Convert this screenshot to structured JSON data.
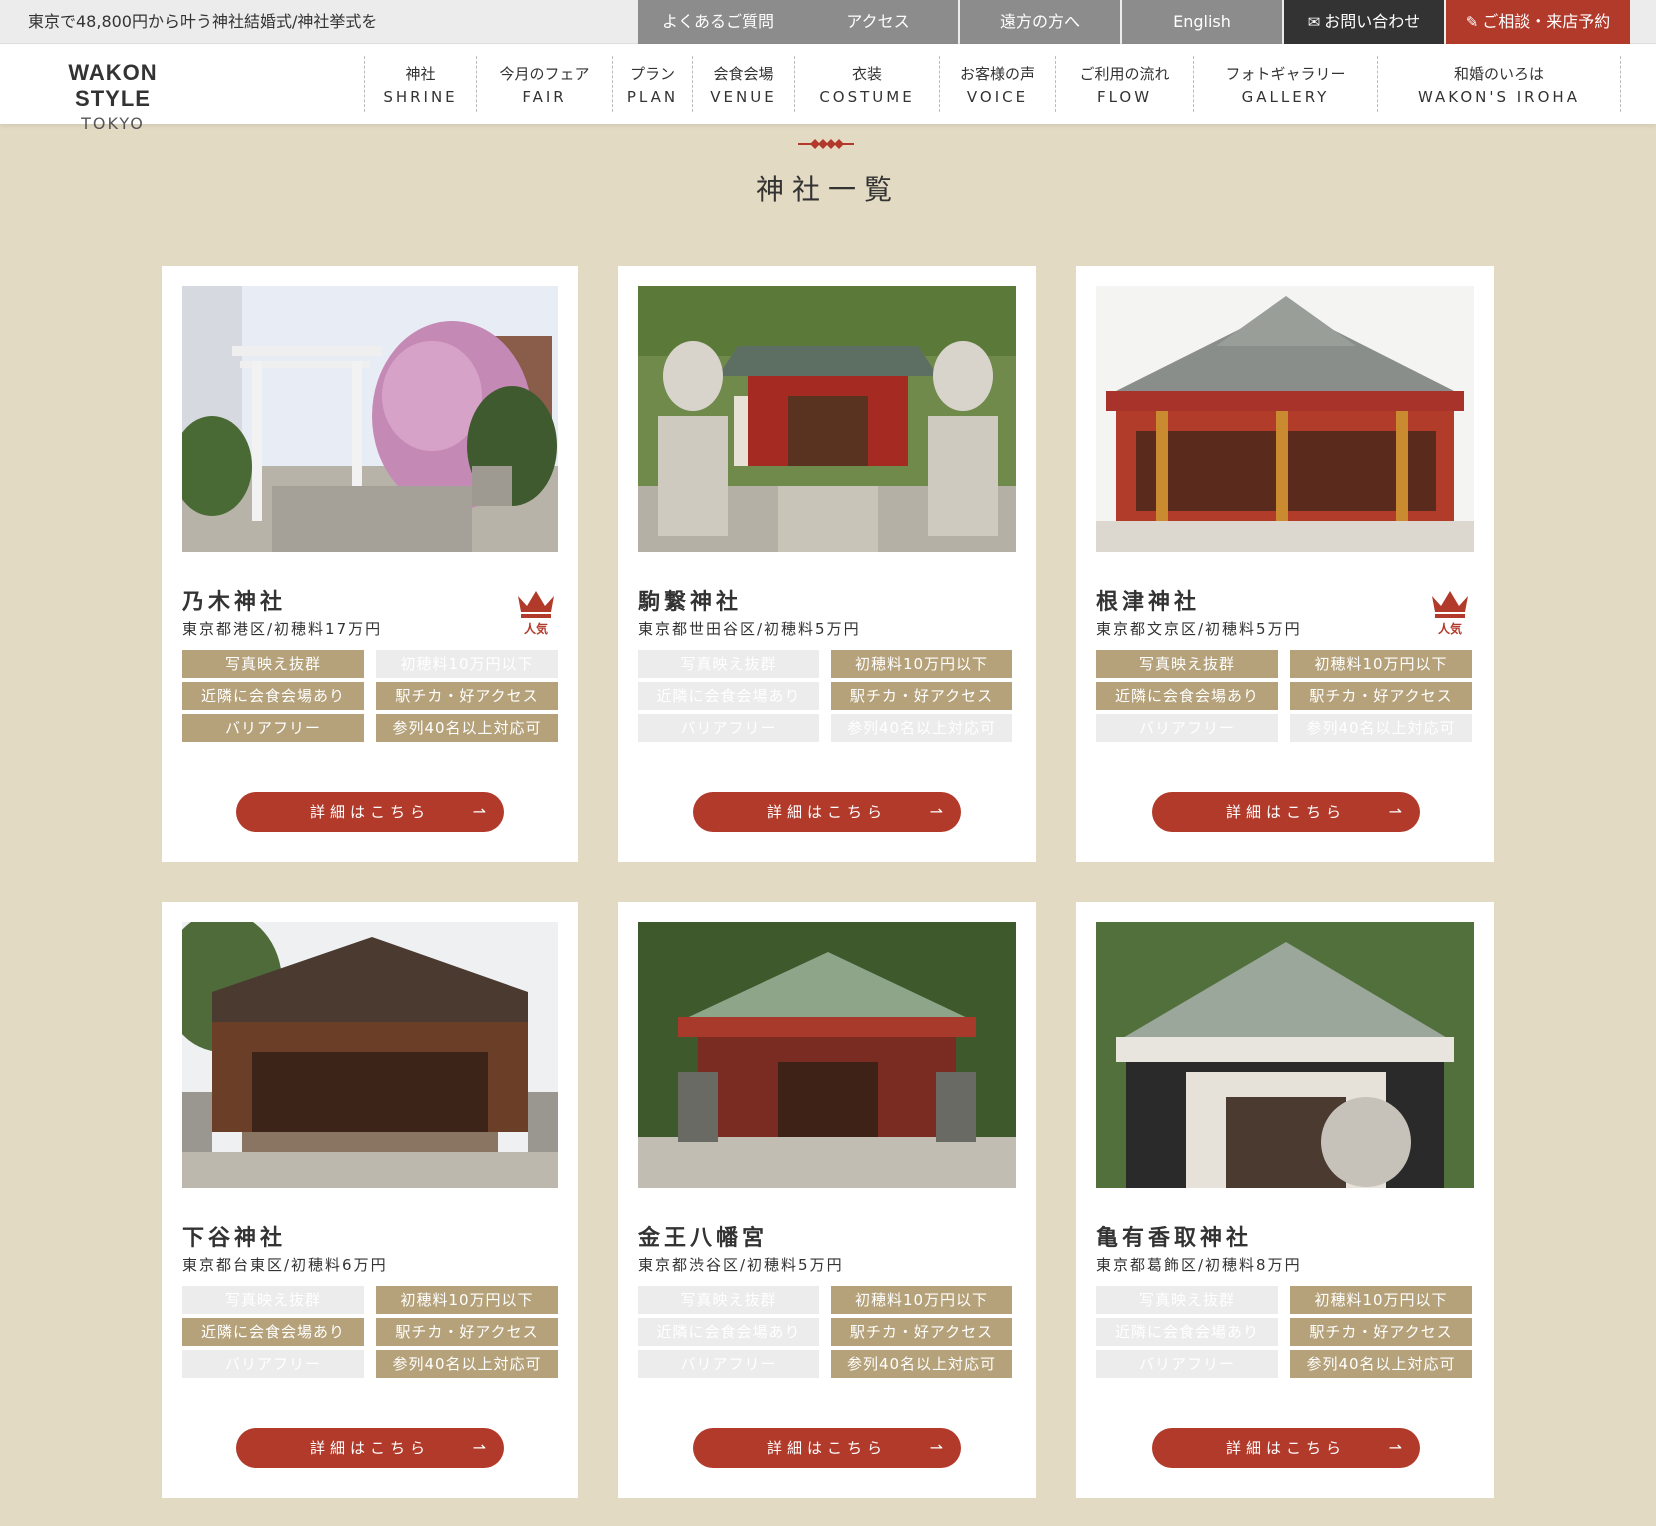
{
  "topbar": {
    "tagline": "東京で48,800円から叶う神社結婚式/神社挙式を",
    "links": {
      "faq": "よくあるご質問",
      "access": "アクセス",
      "far": "遠方の方へ",
      "english": "English",
      "contact": "お問い合わせ",
      "reserve": "ご相談・来店予約"
    }
  },
  "header": {
    "logo_main": "WAKON STYLE",
    "logo_sub": "TOKYO",
    "nav": [
      {
        "jp": "神社",
        "en": "SHRINE"
      },
      {
        "jp": "今月のフェア",
        "en": "FAIR"
      },
      {
        "jp": "プラン",
        "en": "PLAN"
      },
      {
        "jp": "会食会場",
        "en": "VENUE"
      },
      {
        "jp": "衣装",
        "en": "COSTUME"
      },
      {
        "jp": "お客様の声",
        "en": "VOICE"
      },
      {
        "jp": "ご利用の流れ",
        "en": "FLOW"
      },
      {
        "jp": "フォトギャラリー",
        "en": "GALLERY"
      },
      {
        "jp": "和婚のいろは",
        "en": "WAKON'S IROHA"
      }
    ]
  },
  "section_title": "神社一覧",
  "popular_label": "人気",
  "button_label": "詳細はこちら",
  "tag_labels": [
    "写真映え抜群",
    "初穂料10万円以下",
    "近隣に会食会場あり",
    "駅チカ・好アクセス",
    "バリアフリー",
    "参列40名以上対応可"
  ],
  "shrines": [
    {
      "name": "乃木神社",
      "location": "東京都港区/初穂料17万円",
      "popular": true,
      "tags_on": [
        true,
        false,
        true,
        true,
        true,
        true
      ]
    },
    {
      "name": "駒繋神社",
      "location": "東京都世田谷区/初穂料5万円",
      "popular": false,
      "tags_on": [
        false,
        true,
        false,
        true,
        false,
        false
      ]
    },
    {
      "name": "根津神社",
      "location": "東京都文京区/初穂料5万円",
      "popular": true,
      "tags_on": [
        true,
        true,
        true,
        true,
        false,
        false
      ]
    },
    {
      "name": "下谷神社",
      "location": "東京都台東区/初穂料6万円",
      "popular": false,
      "tags_on": [
        false,
        true,
        true,
        true,
        false,
        true
      ]
    },
    {
      "name": "金王八幡宮",
      "location": "東京都渋谷区/初穂料5万円",
      "popular": false,
      "tags_on": [
        false,
        true,
        false,
        true,
        false,
        true
      ]
    },
    {
      "name": "亀有香取神社",
      "location": "東京都葛飾区/初穂料8万円",
      "popular": false,
      "tags_on": [
        false,
        true,
        false,
        true,
        false,
        true
      ]
    }
  ],
  "colors": {
    "accent_red": "#b23a2b",
    "tag_gold": "#b5a27a",
    "tag_off": "#ececec",
    "background": "#e3dac3"
  },
  "icons": {
    "contact": "envelope-icon",
    "reserve": "pencil-icon",
    "popular": "crown-icon",
    "button": "arrow-right-icon"
  }
}
